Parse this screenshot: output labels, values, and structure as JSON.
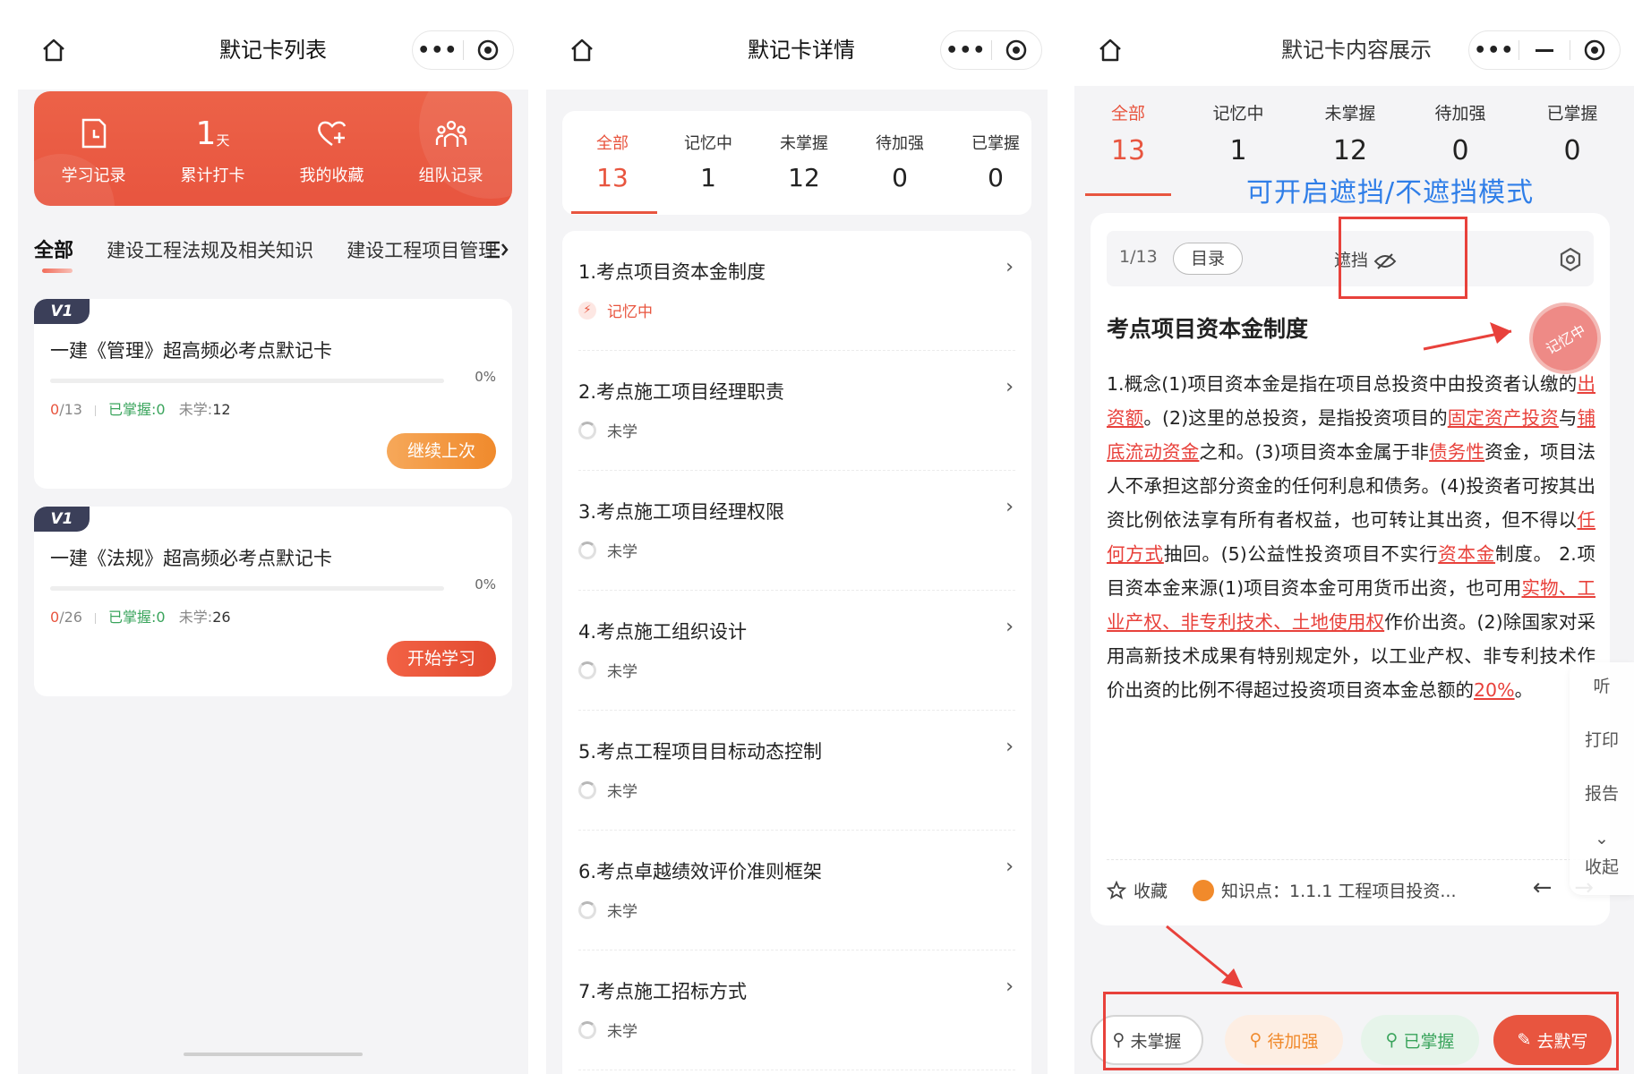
{
  "panel1": {
    "title": "默记卡列表",
    "banner_items": [
      {
        "icon": "clock-doc-icon",
        "label": "学习记录"
      },
      {
        "icon": "day-count-icon",
        "value": "1",
        "unit": "天",
        "label": "累计打卡"
      },
      {
        "icon": "heart-plus-icon",
        "label": "我的收藏"
      },
      {
        "icon": "team-icon",
        "label": "组队记录"
      }
    ],
    "category_tabs": [
      "全部",
      "建设工程法规及相关知识",
      "建设工程项目管理"
    ],
    "cards": [
      {
        "tag": "V1",
        "title": "一建《管理》超高频必考点默记卡",
        "progress": 0,
        "progress_label": "0%",
        "done": "0",
        "total": "/13",
        "mastered": "已掌握:0",
        "unlearned_label": "未学:",
        "unlearned": "12",
        "button": "继续上次"
      },
      {
        "tag": "V1",
        "title": "一建《法规》超高频必考点默记卡",
        "progress": 0,
        "progress_label": "0%",
        "done": "0",
        "total": "/26",
        "mastered": "已掌握:0",
        "unlearned_label": "未学:",
        "unlearned": "26",
        "button": "开始学习"
      }
    ]
  },
  "panel2": {
    "title": "默记卡详情",
    "stats": [
      {
        "label": "全部",
        "value": "13"
      },
      {
        "label": "记忆中",
        "value": "1"
      },
      {
        "label": "未掌握",
        "value": "12"
      },
      {
        "label": "待加强",
        "value": "0"
      },
      {
        "label": "已掌握",
        "value": "0"
      }
    ],
    "items": [
      {
        "title": "1.考点项目资本金制度",
        "status": "记忆中"
      },
      {
        "title": "2.考点施工项目经理职责",
        "status": "未学"
      },
      {
        "title": "3.考点施工项目经理权限",
        "status": "未学"
      },
      {
        "title": "4.考点施工组织设计",
        "status": "未学"
      },
      {
        "title": "5.考点工程项目目标动态控制",
        "status": "未学"
      },
      {
        "title": "6.考点卓越绩效评价准则框架",
        "status": "未学"
      },
      {
        "title": "7.考点施工招标方式",
        "status": "未学"
      }
    ]
  },
  "panel3": {
    "title": "默记卡内容展示",
    "tabs": [
      {
        "label": "全部",
        "value": "13"
      },
      {
        "label": "记忆中",
        "value": "1"
      },
      {
        "label": "未掌握",
        "value": "12"
      },
      {
        "label": "待加强",
        "value": "0"
      },
      {
        "label": "已掌握",
        "value": "0"
      }
    ],
    "annotation": "可开启遮挡/不遮挡模式",
    "page": "1/13",
    "toc": "目录",
    "mask": "遮挡",
    "card_title": "考点项目资本金制度",
    "stamp": "记忆中",
    "body": [
      {
        "t": "1.概念(1)项目资本金是指在项目总投资中由投资者认缴的"
      },
      {
        "u": "出资额"
      },
      {
        "t": "。(2)这里的总投资，是指投资项目的"
      },
      {
        "u": "固定资产投资"
      },
      {
        "t": "与"
      },
      {
        "u": "铺底流动资金"
      },
      {
        "t": "之和。(3)项目资本金属于非"
      },
      {
        "u": "债务性"
      },
      {
        "t": "资金，项目法人不承担这部分资金的任何利息和债务。(4)投资者可按其出资比例依法享有所有者权益，也可转让其出资，但不得以"
      },
      {
        "u": "任何方式"
      },
      {
        "t": "抽回。(5)公益性投资项目不实行"
      },
      {
        "u": "资本金"
      },
      {
        "t": "制度。 2.项目资本金来源(1)项目资本金可用货币出资，也可用"
      },
      {
        "u": "实物、工业产权、非专利技术、土地使用权"
      },
      {
        "t": "作价出资。(2)除国家对采用高新技术成果有特别规定外，以工业产权、非专利技术作价出资的比例不得超过投资项目资本金总额的"
      },
      {
        "u": "20%"
      },
      {
        "t": "。"
      }
    ],
    "side_tools": [
      "听",
      "打印",
      "报告",
      "收起"
    ],
    "favorite": "收藏",
    "knowledge": "知识点：1.1.1 工程项目投资...",
    "buttons": [
      "未掌握",
      "待加强",
      "已掌握",
      "去默写"
    ]
  },
  "colors": {
    "accent": "#e8553f",
    "green": "#3aa45c",
    "orange": "#f08a2c",
    "annotation_blue": "#2f7ee8",
    "annotation_red": "#e8413b"
  }
}
